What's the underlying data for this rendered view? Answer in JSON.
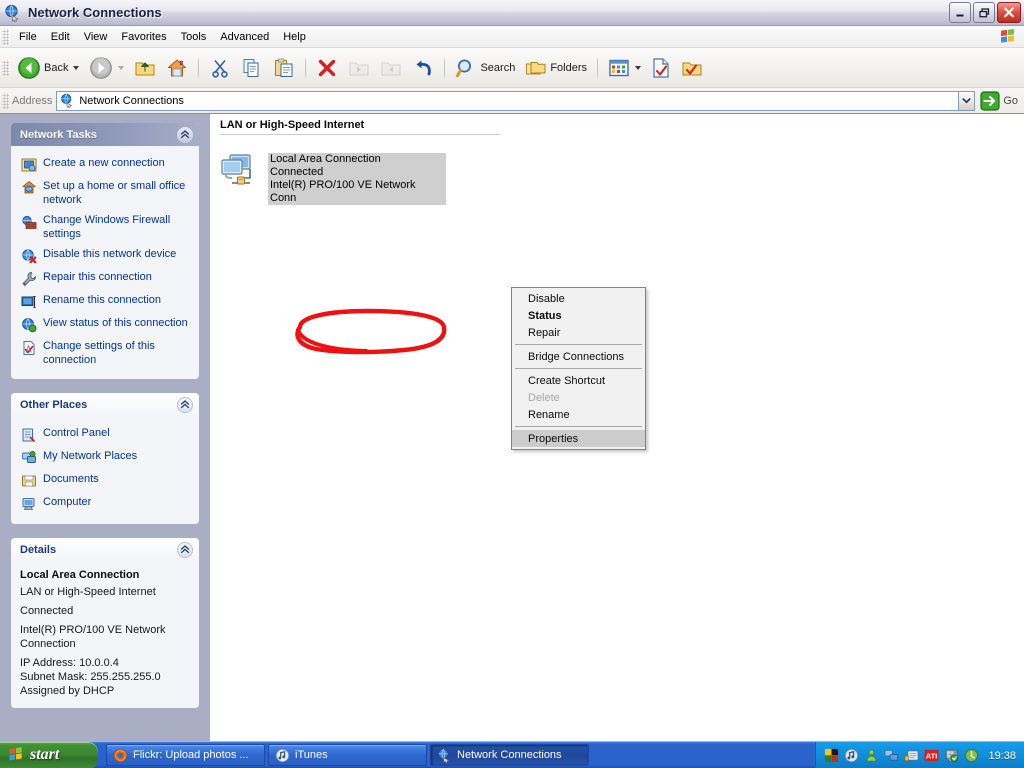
{
  "window": {
    "title": "Network Connections",
    "icon": "globe-network-icon",
    "minimize_label": "Minimize",
    "restore_label": "Restore",
    "close_label": "Close"
  },
  "menubar": {
    "items": [
      {
        "label": "File"
      },
      {
        "label": "Edit"
      },
      {
        "label": "View"
      },
      {
        "label": "Favorites"
      },
      {
        "label": "Tools"
      },
      {
        "label": "Advanced"
      },
      {
        "label": "Help"
      }
    ],
    "brand_icon": "windows-flag-icon"
  },
  "toolbar": {
    "back_label": "Back",
    "forward_label": "Forward",
    "up_label": "Up",
    "home_label": "Home",
    "cut_label": "Cut",
    "copy_label": "Copy",
    "paste_label": "Paste",
    "delete_label": "Delete",
    "undo_label": "Undo",
    "search_label": "Search",
    "folders_label": "Folders",
    "views_label": "Views"
  },
  "address": {
    "label": "Address",
    "value": "Network Connections",
    "icon": "globe-network-icon",
    "go_label": "Go"
  },
  "sidebar": {
    "panels": [
      {
        "title": "Network Tasks",
        "style": "blue",
        "collapse_label": "Collapse",
        "items": [
          {
            "label": "Create a new connection",
            "icon": "new-connection-icon"
          },
          {
            "label": "Set up a home or small office network",
            "icon": "home-network-icon"
          },
          {
            "label": "Change Windows Firewall settings",
            "icon": "firewall-icon"
          },
          {
            "label": "Disable this network device",
            "icon": "disable-device-icon"
          },
          {
            "label": "Repair this connection",
            "icon": "repair-wrench-icon"
          },
          {
            "label": "Rename this connection",
            "icon": "rename-icon"
          },
          {
            "label": "View status of this connection",
            "icon": "view-status-icon"
          },
          {
            "label": "Change settings of this connection",
            "icon": "settings-icon"
          }
        ]
      },
      {
        "title": "Other Places",
        "style": "white",
        "collapse_label": "Collapse",
        "items": [
          {
            "label": "Control Panel",
            "icon": "control-panel-icon"
          },
          {
            "label": "My Network Places",
            "icon": "network-places-icon"
          },
          {
            "label": "Documents",
            "icon": "documents-icon"
          },
          {
            "label": "Computer",
            "icon": "computer-icon"
          }
        ]
      }
    ],
    "details": {
      "title": "Details",
      "style": "white",
      "collapse_label": "Collapse",
      "name": "Local Area Connection",
      "type": "LAN or High-Speed Internet",
      "status": "Connected",
      "adapter": "Intel(R) PRO/100 VE Network Connection",
      "ip_address": "IP Address: 10.0.0.4",
      "subnet_mask": "Subnet Mask: 255.255.255.0",
      "dhcp": "Assigned by DHCP"
    }
  },
  "content": {
    "group_header": "LAN or High-Speed Internet",
    "connection": {
      "name": "Local Area Connection",
      "status": "Connected",
      "adapter": "Intel(R) PRO/100 VE Network Conn",
      "icon": "lan-connection-icon",
      "selected": true
    }
  },
  "context_menu": {
    "items": [
      {
        "label": "Disable",
        "state": "normal"
      },
      {
        "label": "Status",
        "state": "default"
      },
      {
        "label": "Repair",
        "state": "normal"
      },
      {
        "separator": true
      },
      {
        "label": "Bridge Connections",
        "state": "normal"
      },
      {
        "separator": true
      },
      {
        "label": "Create Shortcut",
        "state": "normal"
      },
      {
        "label": "Delete",
        "state": "disabled"
      },
      {
        "label": "Rename",
        "state": "normal"
      },
      {
        "separator": true
      },
      {
        "label": "Properties",
        "state": "highlighted"
      }
    ]
  },
  "annotation": {
    "shape": "ellipse",
    "color": "#ee1111",
    "target": "Properties"
  },
  "taskbar": {
    "start_label": "start",
    "start_icon": "windows-flag-icon",
    "tasks": [
      {
        "label": "Flickr: Upload photos ...",
        "icon": "firefox-icon",
        "active": false
      },
      {
        "label": "iTunes",
        "icon": "itunes-icon",
        "active": false
      },
      {
        "label": "Network Connections",
        "icon": "globe-network-icon",
        "active": true
      }
    ],
    "tray": {
      "icons": [
        "nvidia-icon",
        "itunes-tray-icon",
        "messenger-icon",
        "network-tray-icon",
        "security-alert-icon",
        "ati-icon",
        "antivirus-shield-icon",
        "update-icon"
      ],
      "clock": "19:38"
    }
  },
  "colors": {
    "accent_blue": "#2a63cb",
    "start_green": "#3a8631",
    "annotation_red": "#ee1111",
    "sidebar_bg": "#a9aec4",
    "link_blue": "#00339a"
  }
}
